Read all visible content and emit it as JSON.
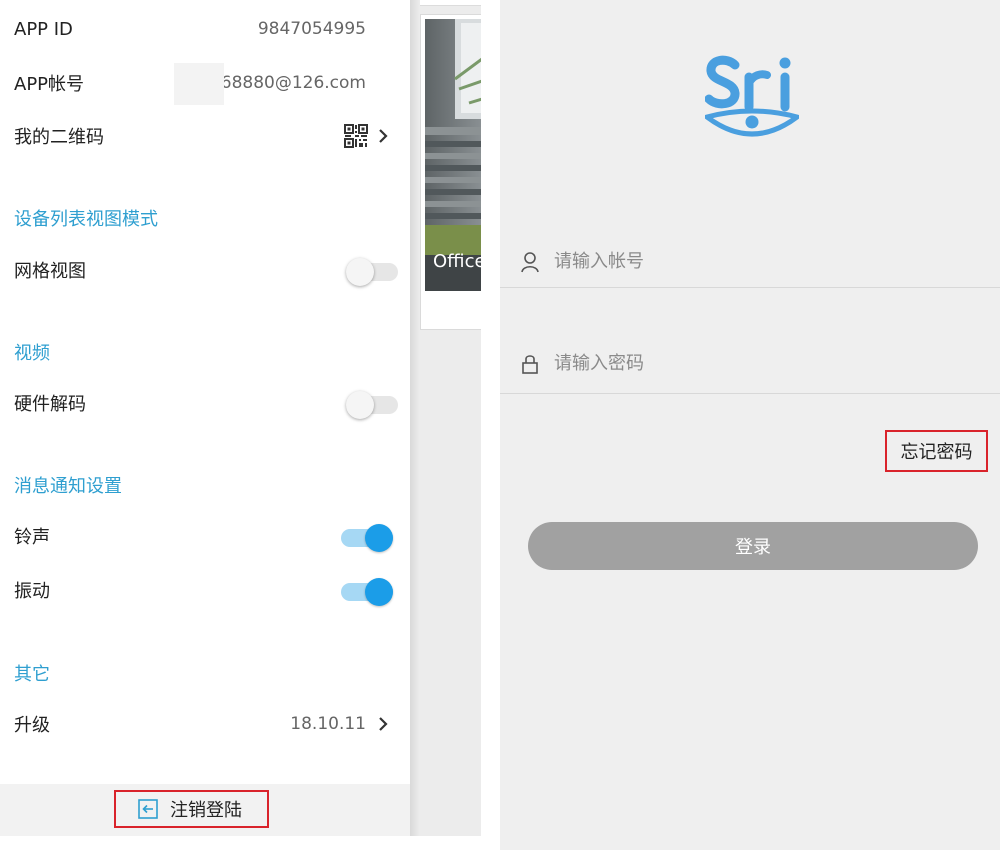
{
  "settings": {
    "app_id_label": "APP ID",
    "app_id_value": "9847054995",
    "account_label": "APP帐号",
    "account_value": "68880@126.com",
    "qr_label": "我的二维码",
    "section_view": "设备列表视图模式",
    "grid_view_label": "网格视图",
    "grid_view_on": false,
    "section_video": "视频",
    "hw_decode_label": "硬件解码",
    "hw_decode_on": false,
    "section_notify": "消息通知设置",
    "ringtone_label": "铃声",
    "ringtone_on": true,
    "vibrate_label": "振动",
    "vibrate_on": true,
    "section_other": "其它",
    "upgrade_label": "升级",
    "upgrade_version": "18.10.11",
    "logout_label": "注销登陆"
  },
  "device_preview": {
    "label": "Office"
  },
  "login": {
    "logo_text": "Sri",
    "account_placeholder": "请输入帐号",
    "password_placeholder": "请输入密码",
    "forgot_label": "忘记密码",
    "login_label": "登录"
  },
  "colors": {
    "accent": "#2f9fd0",
    "toggle_on": "#1b9de8",
    "highlight_border": "#d9232b",
    "login_button": "#a1a1a1",
    "logo_blue": "#4a9fdf"
  }
}
